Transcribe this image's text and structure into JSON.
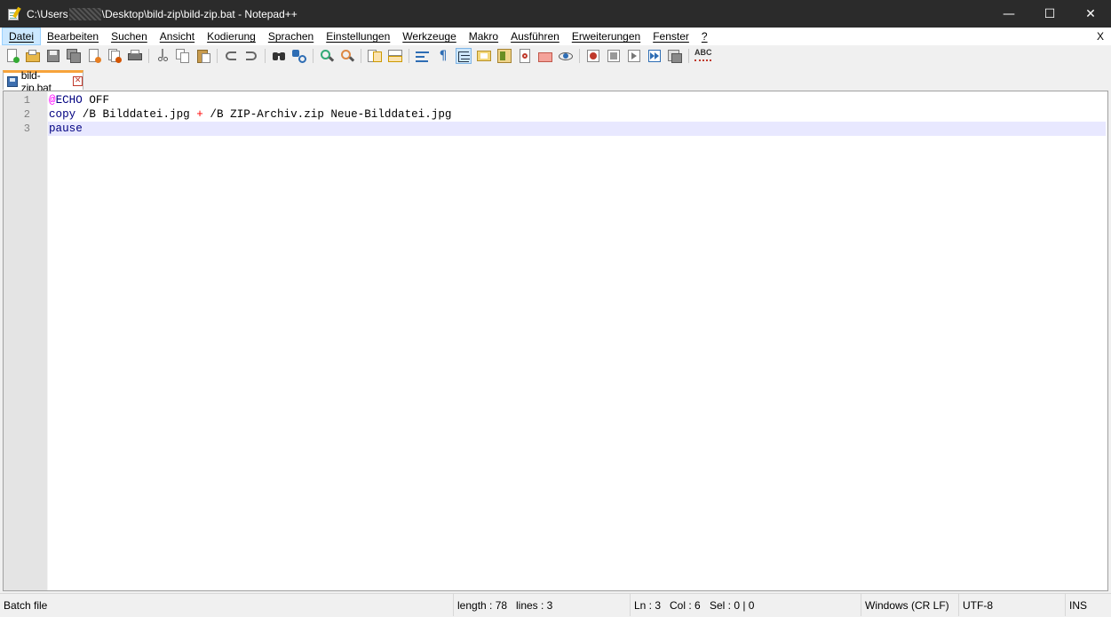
{
  "window": {
    "title_prefix": "C:\\Users",
    "title_suffix": "\\Desktop\\bild-zip\\bild-zip.bat - Notepad++",
    "minimize": "—",
    "maximize": "☐",
    "close": "✕"
  },
  "menu": {
    "items": [
      "Datei",
      "Bearbeiten",
      "Suchen",
      "Ansicht",
      "Kodierung",
      "Sprachen",
      "Einstellungen",
      "Werkzeuge",
      "Makro",
      "Ausführen",
      "Erweiterungen",
      "Fenster",
      "?"
    ],
    "close": "X"
  },
  "toolbar": {
    "icons": [
      "new-file-icon",
      "open-file-icon",
      "save-icon",
      "save-all-icon",
      "close-icon",
      "close-all-icon",
      "print-icon",
      "cut-icon",
      "copy-icon",
      "paste-icon",
      "undo-icon",
      "redo-icon",
      "find-icon",
      "replace-icon",
      "zoom-in-icon",
      "zoom-out-icon",
      "sync-vertical-icon",
      "sync-horizontal-icon",
      "word-wrap-icon",
      "show-all-characters-icon",
      "indent-guide-icon",
      "user-defined-language-icon",
      "document-map-icon",
      "function-list-icon",
      "folder-as-workspace-icon",
      "monitoring-icon",
      "record-macro-icon",
      "stop-macro-icon",
      "play-macro-icon",
      "run-macro-multiple-icon",
      "save-macro-icon",
      "spell-check-icon"
    ],
    "spell_label": "ABC"
  },
  "tab": {
    "label": "bild-zip.bat",
    "close": "✕"
  },
  "editor": {
    "line_numbers": [
      "1",
      "2",
      "3"
    ],
    "lines": [
      {
        "at": "@",
        "kw": "ECHO",
        "rest": " OFF"
      },
      {
        "kw": "copy",
        "part1": " /B Bilddatei.jpg ",
        "op": "+",
        "part2": " /B ZIP-Archiv.zip Neue-Bilddatei.jpg"
      },
      {
        "kw": "pause"
      }
    ]
  },
  "status": {
    "file_type": "Batch file",
    "length": "length : 78",
    "lines": "lines : 3",
    "ln": "Ln : 3",
    "col": "Col : 6",
    "sel": "Sel : 0 | 0",
    "eol": "Windows (CR LF)",
    "encoding": "UTF-8",
    "mode": "INS"
  }
}
